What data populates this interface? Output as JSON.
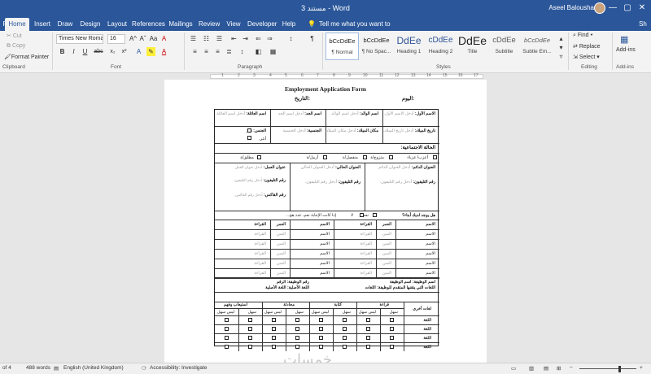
{
  "window": {
    "title": "ﻣﺴﺘﻨﺪ 3 - Word",
    "user": "Aseel Balousha",
    "min_glyph": "—",
    "max_glyph": "▢",
    "close_glyph": "✕"
  },
  "tabs": [
    "File",
    "Home",
    "Insert",
    "Draw",
    "Design",
    "Layout",
    "References",
    "Mailings",
    "Review",
    "View",
    "Developer",
    "Help"
  ],
  "tell_me": "Tell me what you want to do",
  "share": "Sh",
  "ribbon": {
    "clipboard": {
      "cut": "Cut",
      "copy": "Copy",
      "format_painter": "Format Painter",
      "label": "Clipboard",
      "paste": "Paste"
    },
    "font": {
      "name": "Times New Roman",
      "size": "16",
      "label": "Font",
      "bold": "B",
      "italic": "I",
      "underline": "U",
      "strike": "abc",
      "sub": "x₂",
      "sup": "x²",
      "color_a": "A",
      "grow": "A^",
      "shrink": "Aˇ",
      "case": "Aa",
      "clear": "A"
    },
    "paragraph": {
      "label": "Paragraph",
      "pilcrow": "¶",
      "sort": "↕"
    },
    "styles": {
      "label": "Styles",
      "items": [
        {
          "preview": "bCcDdEe",
          "name": "¶ Normal"
        },
        {
          "preview": "bCcDdEe",
          "name": "¶ No Spac..."
        },
        {
          "preview": "DdEe",
          "name": "Heading 1"
        },
        {
          "preview": "cDdEe",
          "name": "Heading 2"
        },
        {
          "preview": "DdEe",
          "name": "Title"
        },
        {
          "preview": "cDdEe",
          "name": "Subtitle"
        },
        {
          "preview": "bCcDdEe",
          "name": "Subtle Em..."
        }
      ]
    },
    "editing": {
      "find": "Find",
      "replace": "Replace",
      "select": "Select",
      "label": "Editing"
    },
    "addins": {
      "name": "Add-ins",
      "label": "Add-ins"
    }
  },
  "ruler": [
    "1",
    "2",
    "3",
    "4",
    "5",
    "6",
    "7",
    "8",
    "9",
    "10",
    "11",
    "12",
    "13",
    "14",
    "15",
    "16",
    "17"
  ],
  "doc": {
    "title": "Employment Application Form",
    "day_label": "اليوم:",
    "date_label": "التاريخ:",
    "r1": {
      "first_label": "الاسم الأول:",
      "first_ph": "أدخل الاسم الأول.",
      "father_label": "اسم الوالد:",
      "father_ph": "أدخل اسم الوالد.",
      "grand_label": "اسم الجد:",
      "grand_ph": "أدخل اسم الجد.",
      "family_label": "اسم العائلة:",
      "family_ph": "أدخل اسم العائلة."
    },
    "r2": {
      "dob_label": "تاريخ الميلاد:",
      "dob_ph": "أدخل تاريخ الميلاد.",
      "pob_label": "مكان الميلاد:",
      "pob_ph": "أدخل مكان الميلاد.",
      "nat_label": "الجنسية:",
      "nat_ph": "أدخل الجنسية",
      "sex_label": "الجنس:",
      "male": "ذكر",
      "female": "أنثى"
    },
    "marital": {
      "label": "الحالة الاجتماعية:",
      "single": "أعزب/ عزباء",
      "married": "متزوج/ة",
      "separated": "منفصل/ة",
      "widowed": "أرمل/ة",
      "divorced": "مطلق/ة"
    },
    "addr": {
      "perm_label": "العنوان الدائم:",
      "perm_ph": "أدخل العنوان الدائم",
      "cur_label": "العنوان الحالي:",
      "cur_ph": "أدخل العنوان الحالي",
      "work_label": "عنوان العمل:",
      "work_ph": "أدخل عنوان العمل",
      "phone_label": "رقم التليفون:",
      "phone_ph": "أدخل رقم التليفون.",
      "phone2_label": "رقم التليفون:",
      "phone2_ph": "أدخل رقم التليفون.",
      "phone3_label": "رقم التليفون:",
      "phone3_ph": "أدخل رقم التليفون.",
      "fax_label": "رقم الفاكس:",
      "fax_ph": "أدخل رقم الفاكس."
    },
    "kids": {
      "question": "هل يوجد لديك أبناء؟",
      "yes": "نعم",
      "no": "لا",
      "ifyes": "إذا كانت الإجابة نعم، عدد هؤ..."
    },
    "kids_table": {
      "headers": {
        "name": "الاسم",
        "age": "العمر",
        "study": "القراءة"
      },
      "name_cell": "الاسم",
      "age_ph": "السن",
      "study_ph": "القراءة"
    },
    "job": {
      "job_name": "اسم الوظيفة: اسم الوظيفة",
      "job_no": "رقم الوظيفة: الرقم",
      "langs": "اللغات التي يتقنها المتقدم للوظيفة: اللغات",
      "native": "اللغة الأصلية: اللغة الأصلية"
    },
    "lang_table": {
      "other": "لغات أخرى",
      "reading": "قراءة",
      "writing": "كتابة",
      "speaking": "محادثة",
      "listening": "استيعاب وفهم",
      "easy": "سهل",
      "hard": "ليس سهل",
      "row": "اللغة"
    }
  },
  "status": {
    "page": "of 4",
    "words": "488 words",
    "lang": "English (United Kingdom)",
    "access": "Accessibility: Investigate"
  },
  "watermark": "خمسات"
}
